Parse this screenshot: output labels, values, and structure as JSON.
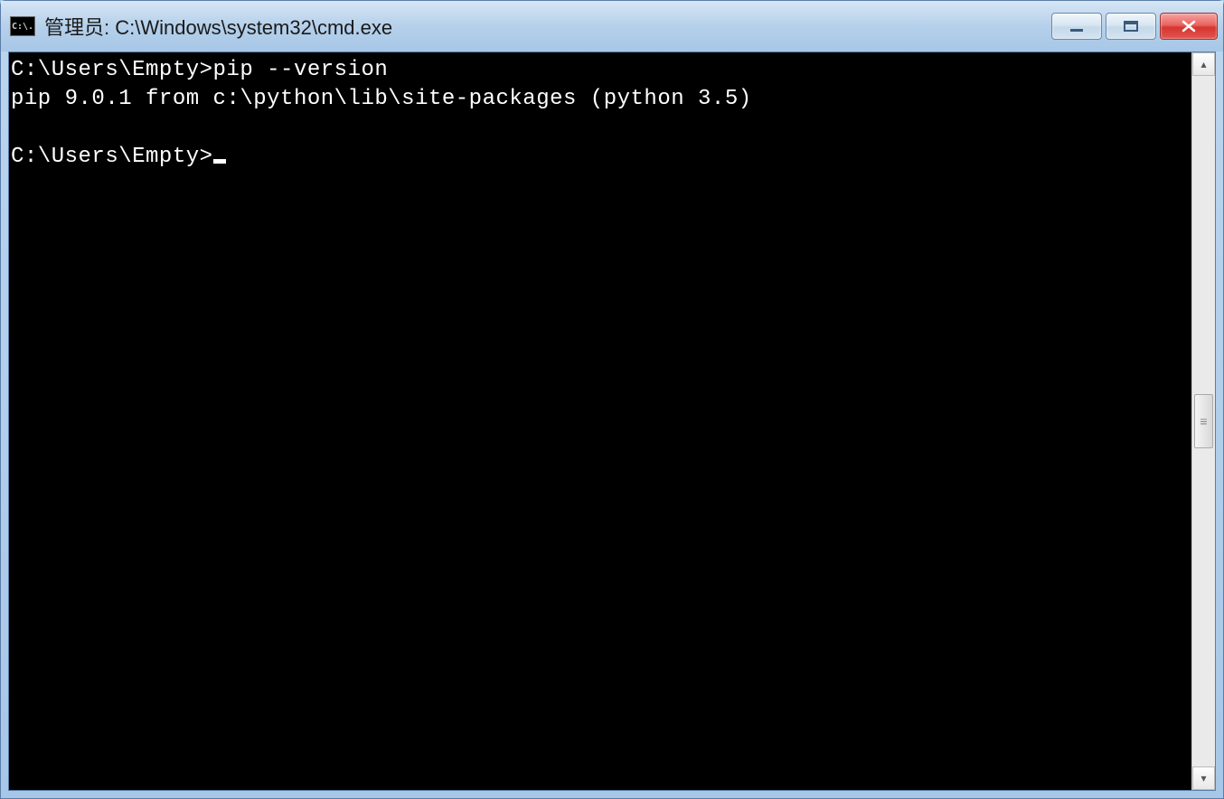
{
  "window": {
    "icon_text": "C:\\.",
    "title": "管理员: C:\\Windows\\system32\\cmd.exe"
  },
  "terminal": {
    "line1_prompt": "C:\\Users\\Empty>",
    "line1_command": "pip --version",
    "line2_output": "pip 9.0.1 from c:\\python\\lib\\site-packages (python 3.5)",
    "line3_blank": "",
    "line4_prompt": "C:\\Users\\Empty>"
  }
}
